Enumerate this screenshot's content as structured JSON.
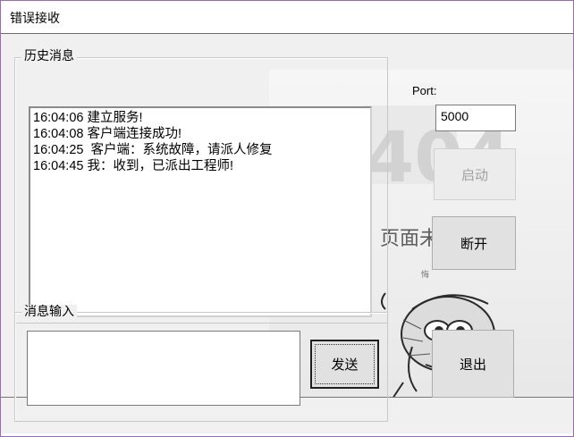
{
  "window": {
    "title": "错误接收"
  },
  "history": {
    "label": "历史消息",
    "lines": [
      "16:04:06 建立服务!",
      "16:04:08 客户端连接成功!",
      "16:04:25  客户端：系统故障，请派人修复",
      "16:04:45 我：收到，已派出工程师!"
    ]
  },
  "input_group": {
    "label": "消息输入",
    "value": ""
  },
  "port": {
    "label": "Port:",
    "value": "5000"
  },
  "buttons": {
    "start": "启动",
    "disconnect": "断开",
    "send": "发送",
    "exit": "退出"
  }
}
